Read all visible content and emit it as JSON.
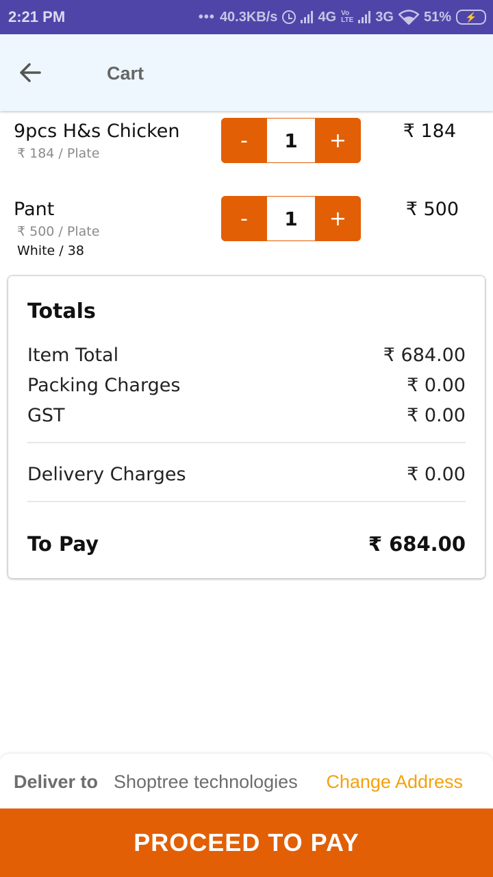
{
  "status_bar": {
    "time": "2:21 PM",
    "dots": "•••",
    "net_speed": "40.3KB/s",
    "net_4g": "4G",
    "volte_top": "Vo",
    "volte_bottom": "LTE",
    "net_3g": "3G",
    "battery": "51%"
  },
  "header": {
    "title": "Cart"
  },
  "cart": {
    "items": [
      {
        "name": "9pcs H&s Chicken",
        "unit_price": "₹ 184 / Plate",
        "variant": "",
        "qty": "1",
        "price": "₹ 184",
        "minus": "-",
        "plus": "+"
      },
      {
        "name": "Pant",
        "unit_price": "₹ 500 / Plate",
        "variant": "White / 38",
        "qty": "1",
        "price": "₹ 500",
        "minus": "-",
        "plus": "+"
      }
    ]
  },
  "totals": {
    "heading": "Totals",
    "item_total_label": "Item Total",
    "item_total_value": "₹ 684.00",
    "packing_label": "Packing Charges",
    "packing_value": "₹ 0.00",
    "gst_label": "GST",
    "gst_value": "₹ 0.00",
    "delivery_label": "Delivery Charges",
    "delivery_value": "₹ 0.00",
    "to_pay_label": "To Pay",
    "to_pay_value": "₹ 684.00"
  },
  "delivery": {
    "label": "Deliver to",
    "address": "Shoptree technologies",
    "change_label": "Change Address"
  },
  "checkout": {
    "button_label": "PROCEED TO PAY"
  },
  "colors": {
    "accent": "#e25f05",
    "status_bar": "#4f45a9",
    "header_bg": "#eef7fd",
    "link": "#f4a10a"
  }
}
